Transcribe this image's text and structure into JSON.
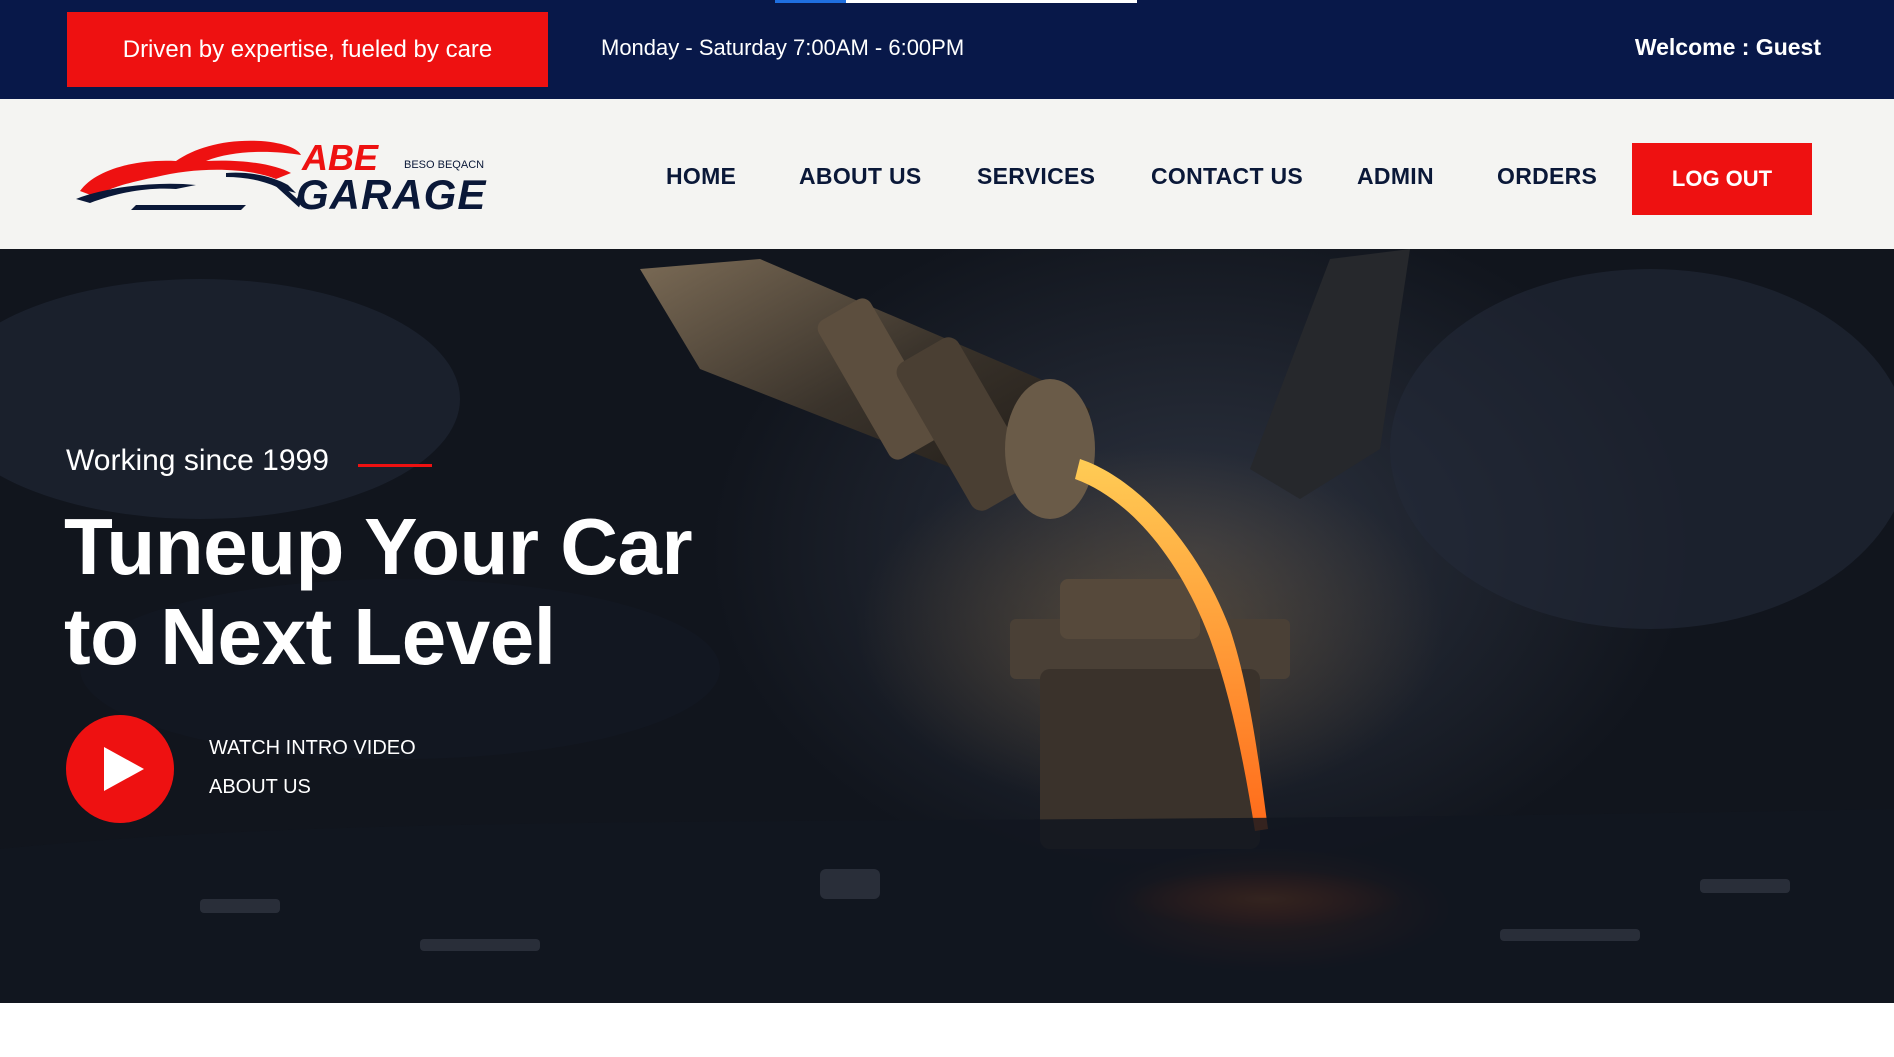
{
  "topbar": {
    "tagline": "Driven by expertise, fueled by care",
    "hours": "Monday - Saturday 7:00AM - 6:00PM",
    "welcome": "Welcome : Guest"
  },
  "logo": {
    "brand": "ABE",
    "name": "GARAGE",
    "small_text": "BESO BEQACN"
  },
  "nav": {
    "items": [
      {
        "label": "HOME"
      },
      {
        "label": "ABOUT US"
      },
      {
        "label": "SERVICES"
      },
      {
        "label": "CONTACT US"
      },
      {
        "label": "ADMIN"
      },
      {
        "label": "ORDERS"
      }
    ],
    "logout_label": "LOG OUT"
  },
  "hero": {
    "subtitle": "Working since 1999",
    "title_line1": "Tuneup Your Car",
    "title_line2": "to Next Level",
    "watch_video": "WATCH INTRO VIDEO",
    "about_us": "ABOUT US",
    "play_icon": "play-icon"
  },
  "colors": {
    "topbar_bg": "#081849",
    "accent_red": "#ee1111",
    "nav_text": "#0a1838",
    "navbar_bg": "#f4f4f2"
  }
}
